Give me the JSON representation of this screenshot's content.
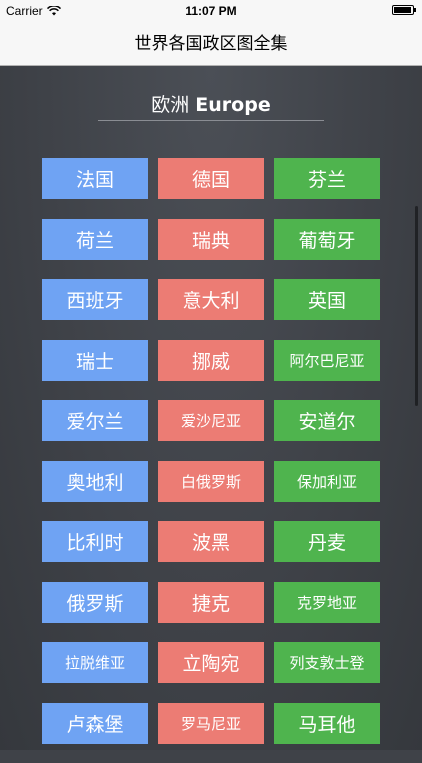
{
  "status_bar": {
    "carrier": "Carrier",
    "time": "11:07 PM"
  },
  "nav": {
    "title": "世界各国政区图全集"
  },
  "section": {
    "title_cn": "欧洲",
    "title_en": "Europe"
  },
  "colors": {
    "col1": "#6fa3f3",
    "col2": "#ec7c74",
    "col3": "#4fb44e"
  },
  "rows": [
    [
      "法国",
      "德国",
      "芬兰"
    ],
    [
      "荷兰",
      "瑞典",
      "葡萄牙"
    ],
    [
      "西班牙",
      "意大利",
      "英国"
    ],
    [
      "瑞士",
      "挪威",
      "阿尔巴尼亚"
    ],
    [
      "爱尔兰",
      "爱沙尼亚",
      "安道尔"
    ],
    [
      "奥地利",
      "白俄罗斯",
      "保加利亚"
    ],
    [
      "比利时",
      "波黑",
      "丹麦"
    ],
    [
      "俄罗斯",
      "捷克",
      "克罗地亚"
    ],
    [
      "拉脱维亚",
      "立陶宛",
      "列支敦士登"
    ],
    [
      "卢森堡",
      "罗马尼亚",
      "马耳他"
    ]
  ]
}
